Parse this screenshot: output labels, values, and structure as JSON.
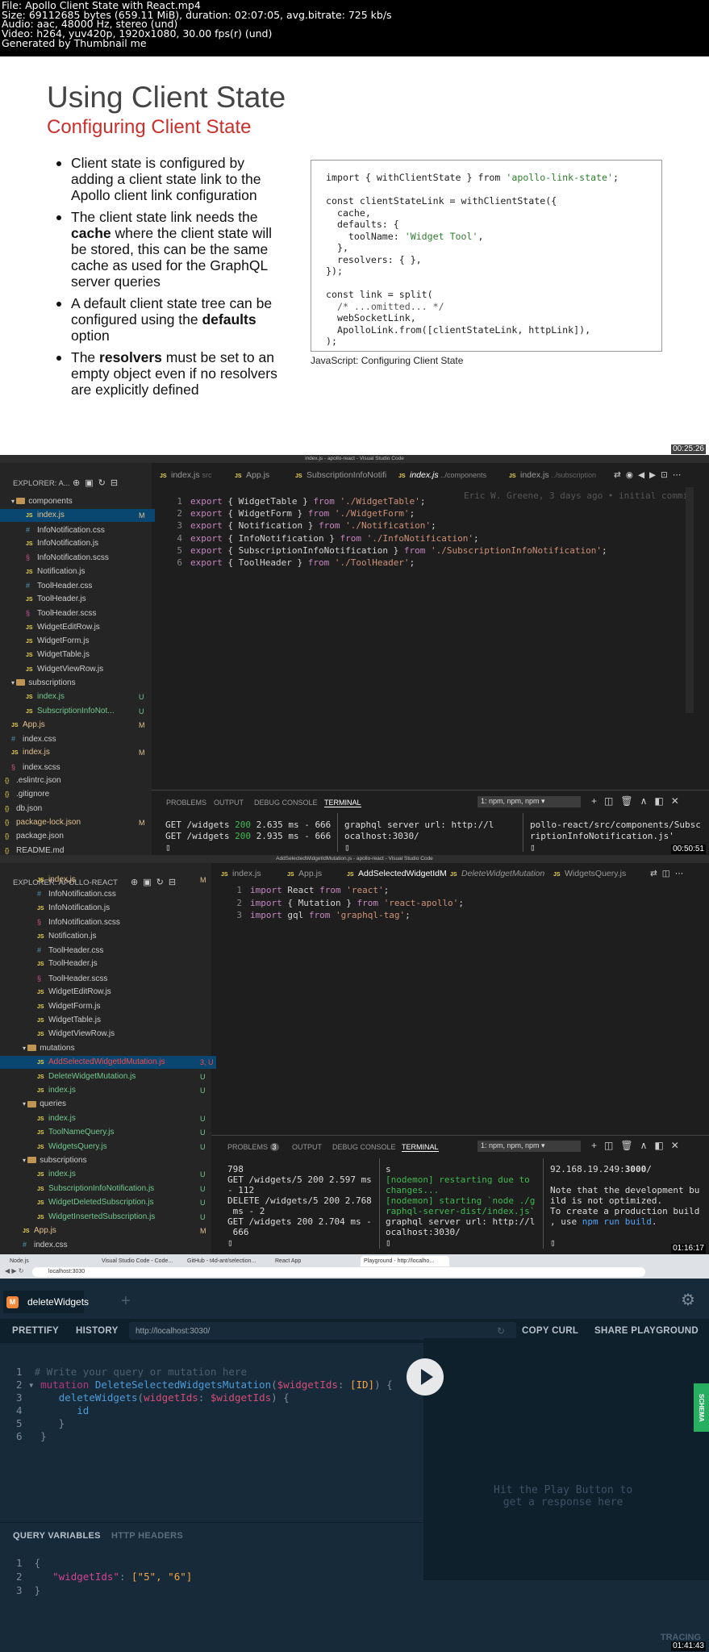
{
  "header": {
    "lines": [
      "File: Apollo Client State with React.mp4",
      "Size: 69112685 bytes (659.11 MiB), duration: 02:07:05, avg.bitrate: 725 kb/s",
      "Audio: aac, 48000 Hz, stereo (und)",
      "Video: h264, yuv420p, 1920x1080, 30.00 fps(r) (und)",
      "Generated by Thumbnail me"
    ]
  },
  "slide": {
    "title": "Using Client State",
    "subtitle": "Configuring Client State",
    "bullets": [
      [
        "Client state is configured by adding a client state link to the Apollo client link configuration"
      ],
      [
        "The client state link needs the ",
        "cache",
        " where the client state will be stored, this can be the same cache as used for the GraphQL server queries"
      ],
      [
        "A default client state tree can be configured using the ",
        "defaults",
        " option"
      ],
      [
        "The ",
        "resolvers",
        " must be set to an empty object even if no resolvers are explicitly defined"
      ]
    ],
    "code_lines": [
      [
        "import { withClientState } from ",
        "'apollo-link-state'",
        ";"
      ],
      [
        ""
      ],
      [
        "const clientStateLink = withClientState({"
      ],
      [
        "  cache,"
      ],
      [
        "  defaults: {"
      ],
      [
        "    toolName: ",
        "'Widget Tool'",
        ","
      ],
      [
        "  },"
      ],
      [
        "  resolvers: { },"
      ],
      [
        "});"
      ],
      [
        ""
      ],
      [
        "const link = split("
      ],
      [
        "  /* ...omitted... */"
      ],
      [
        "  webSocketLink,"
      ],
      [
        "  ApolloLink.from([clientStateLink, httpLink]),"
      ],
      [
        ");"
      ]
    ],
    "caption": "JavaScript: Configuring Client State",
    "timestamp": "00:25:26"
  },
  "vscode1": {
    "title": "index.js - apollo-react - Visual Studio Code",
    "explorer": "EXPLORER: A...",
    "tabs": [
      "index.js",
      "App.js",
      "SubscriptionInfoNotifi",
      "index.js",
      "index.js"
    ],
    "tab_paths": [
      "src",
      "",
      "",
      "../components",
      "../subscription"
    ],
    "tree": [
      {
        "label": "components",
        "type": "folder",
        "badge": ""
      },
      {
        "label": "index.js",
        "type": "js",
        "badge": "M"
      },
      {
        "label": "InfoNotification.css",
        "type": "css",
        "badge": ""
      },
      {
        "label": "InfoNotification.js",
        "type": "js",
        "badge": ""
      },
      {
        "label": "InfoNotification.scss",
        "type": "scss",
        "badge": ""
      },
      {
        "label": "Notification.js",
        "type": "js",
        "badge": ""
      },
      {
        "label": "ToolHeader.css",
        "type": "css",
        "badge": ""
      },
      {
        "label": "ToolHeader.js",
        "type": "js",
        "badge": ""
      },
      {
        "label": "ToolHeader.scss",
        "type": "scss",
        "badge": ""
      },
      {
        "label": "WidgetEditRow.js",
        "type": "js",
        "badge": ""
      },
      {
        "label": "WidgetForm.js",
        "type": "js",
        "badge": ""
      },
      {
        "label": "WidgetTable.js",
        "type": "js",
        "badge": ""
      },
      {
        "label": "WidgetViewRow.js",
        "type": "js",
        "badge": ""
      },
      {
        "label": "subscriptions",
        "type": "folder",
        "badge": ""
      },
      {
        "label": "index.js",
        "type": "js",
        "badge": "U"
      },
      {
        "label": "SubscriptionInfoNot...",
        "type": "js",
        "badge": "U"
      },
      {
        "label": "App.js",
        "type": "js",
        "badge": "M"
      },
      {
        "label": "index.css",
        "type": "css",
        "badge": ""
      },
      {
        "label": "index.js",
        "type": "js",
        "badge": "M"
      },
      {
        "label": "index.scss",
        "type": "scss",
        "badge": ""
      },
      {
        "label": ".eslintrc.json",
        "type": "json",
        "badge": ""
      },
      {
        "label": ".gitignore",
        "type": "json",
        "badge": ""
      },
      {
        "label": "db.json",
        "type": "json",
        "badge": ""
      },
      {
        "label": "package-lock.json",
        "type": "json",
        "badge": "M"
      },
      {
        "label": "package.json",
        "type": "json",
        "badge": ""
      },
      {
        "label": "README.md",
        "type": "json",
        "badge": ""
      }
    ],
    "code": [
      [
        "export",
        " { WidgetTable } ",
        "from",
        " './WidgetTable'",
        ";"
      ],
      [
        "export",
        " { WidgetForm } ",
        "from",
        " './WidgetForm'",
        ";"
      ],
      [
        "export",
        " { Notification } ",
        "from",
        " './Notification'",
        ";"
      ],
      [
        "export",
        " { InfoNotification } ",
        "from",
        " './InfoNotification'",
        ";"
      ],
      [
        "export",
        " { SubscriptionInfoNotification } ",
        "from",
        " './SubscriptionInfoNotification'",
        ";"
      ],
      [
        "export",
        " { ToolHeader } ",
        "from",
        " './ToolHeader'",
        ";"
      ]
    ],
    "blame": "Eric W. Greene, 3 days ago • initial commit",
    "panel_tabs": [
      "PROBLEMS",
      "OUTPUT",
      "DEBUG CONSOLE",
      "TERMINAL"
    ],
    "terminal_select": "1: npm, npm, npm",
    "term1": [
      [
        "GET /widgets ",
        "200",
        " 2.635 ms - 666"
      ],
      [
        "GET /widgets ",
        "200",
        " 2.935 ms - 666"
      ]
    ],
    "term2": [
      "graphql server url: http://l",
      "ocalhost:3030/"
    ],
    "term3": [
      "pollo-react/src/components/Subsc",
      "riptionInfoNotification.js'"
    ],
    "timestamp": "00:50:51"
  },
  "vscode2": {
    "title": "AddSelectedWidgetIdMutation.js - apollo-react - Visual Studio Code",
    "explorer": "EXPLORER: APOLLO-REACT",
    "tabs": [
      "index.js",
      "App.js",
      "AddSelectedWidgetIdM",
      "DeleteWidgetMutation",
      "WidgetsQuery.js"
    ],
    "tree": [
      {
        "label": "index.js",
        "type": "js",
        "badge": "M"
      },
      {
        "label": "InfoNotification.css",
        "type": "css",
        "badge": ""
      },
      {
        "label": "InfoNotification.js",
        "type": "js",
        "badge": ""
      },
      {
        "label": "InfoNotification.scss",
        "type": "scss",
        "badge": ""
      },
      {
        "label": "Notification.js",
        "type": "js",
        "badge": ""
      },
      {
        "label": "ToolHeader.css",
        "type": "css",
        "badge": ""
      },
      {
        "label": "ToolHeader.js",
        "type": "js",
        "badge": ""
      },
      {
        "label": "ToolHeader.scss",
        "type": "scss",
        "badge": ""
      },
      {
        "label": "WidgetEditRow.js",
        "type": "js",
        "badge": ""
      },
      {
        "label": "WidgetForm.js",
        "type": "js",
        "badge": ""
      },
      {
        "label": "WidgetTable.js",
        "type": "js",
        "badge": ""
      },
      {
        "label": "WidgetViewRow.js",
        "type": "js",
        "badge": ""
      },
      {
        "label": "mutations",
        "type": "folder",
        "badge": ""
      },
      {
        "label": "AddSelectedWidgetIdMutation.js",
        "type": "js",
        "badge": "3, U"
      },
      {
        "label": "DeleteWidgetMutation.js",
        "type": "js",
        "badge": "U"
      },
      {
        "label": "index.js",
        "type": "js",
        "badge": "U"
      },
      {
        "label": "queries",
        "type": "folder",
        "badge": ""
      },
      {
        "label": "index.js",
        "type": "js",
        "badge": "U"
      },
      {
        "label": "ToolNameQuery.js",
        "type": "js",
        "badge": "U"
      },
      {
        "label": "WidgetsQuery.js",
        "type": "js",
        "badge": "U"
      },
      {
        "label": "subscriptions",
        "type": "folder",
        "badge": ""
      },
      {
        "label": "index.js",
        "type": "js",
        "badge": "U"
      },
      {
        "label": "SubscriptionInfoNotification.js",
        "type": "js",
        "badge": "U"
      },
      {
        "label": "WidgetDeletedSubscription.js",
        "type": "js",
        "badge": "U"
      },
      {
        "label": "WidgetInsertedSubscription.js",
        "type": "js",
        "badge": "U"
      },
      {
        "label": "App.js",
        "type": "js",
        "badge": "M"
      },
      {
        "label": "index.css",
        "type": "css",
        "badge": ""
      }
    ],
    "code": [
      [
        "import",
        " React ",
        "from",
        " 'react'",
        ";"
      ],
      [
        "import",
        " { Mutation } ",
        "from",
        " 'react-apollo'",
        ";"
      ],
      [
        "import",
        " gql ",
        "from",
        " 'graphql-tag'",
        ";"
      ]
    ],
    "panel_tabs": [
      "PROBLEMS",
      "3",
      "OUTPUT",
      "DEBUG CONSOLE",
      "TERMINAL"
    ],
    "terminal_select": "1: npm, npm, npm",
    "term1": [
      "798",
      "GET /widgets/5 200 2.597 ms",
      "- 112",
      "DELETE /widgets/5 200 2.768",
      " ms - 2",
      "GET /widgets 200 2.704 ms -",
      " 666"
    ],
    "term2": [
      "s",
      "[nodemon] restarting due to",
      "changes...",
      "[nodemon] starting `node ./g",
      "raphql-server-dist/index.js`",
      "graphql server url: http://l",
      "ocalhost:3030/"
    ],
    "term3": [
      "92.168.19.249:",
      "3000",
      "/",
      "",
      "Note that the development bu",
      "ild is not optimized.",
      "To create a production build",
      ", use ",
      "npm run build",
      "."
    ],
    "timestamp": "01:16:17"
  },
  "browser": {
    "tabs": [
      "Node.js",
      "Visual Studio Code - Code...",
      "GitHub - t4d-ant/selection...",
      "React App",
      "Playground - http://localho..."
    ],
    "url": "localhost:3030"
  },
  "playground": {
    "tab_label": "deleteWidgets",
    "tab_icon": "M",
    "prettify": "PRETTIFY",
    "history": "HISTORY",
    "endpoint": "http://localhost:3030/",
    "copy_curl": "COPY CURL",
    "share": "SHARE PLAYGROUND",
    "schema": "SCHEMA",
    "query_comment": "# Write your query or mutation here",
    "query_mut": "mutation",
    "query_name": "DeleteSelectedWidgetsMutation",
    "query_var": "$widgetIds",
    "query_type": "[ID]",
    "query_field": "deleteWidgets",
    "query_arg": "widgetIds",
    "query_id": "id",
    "response_hint_1": "Hit the Play Button to",
    "response_hint_2": "get a response here",
    "vars_tab": "QUERY VARIABLES",
    "headers_tab": "HTTP HEADERS",
    "vars_key": "\"widgetIds\"",
    "vars_vals": "[\"5\", \"6\"]",
    "tracing": "TRACING",
    "timestamp": "01:41:43",
    "colors": {
      "bg": "#172a3a",
      "bar": "#0f202d",
      "schema": "#27ae60"
    }
  }
}
